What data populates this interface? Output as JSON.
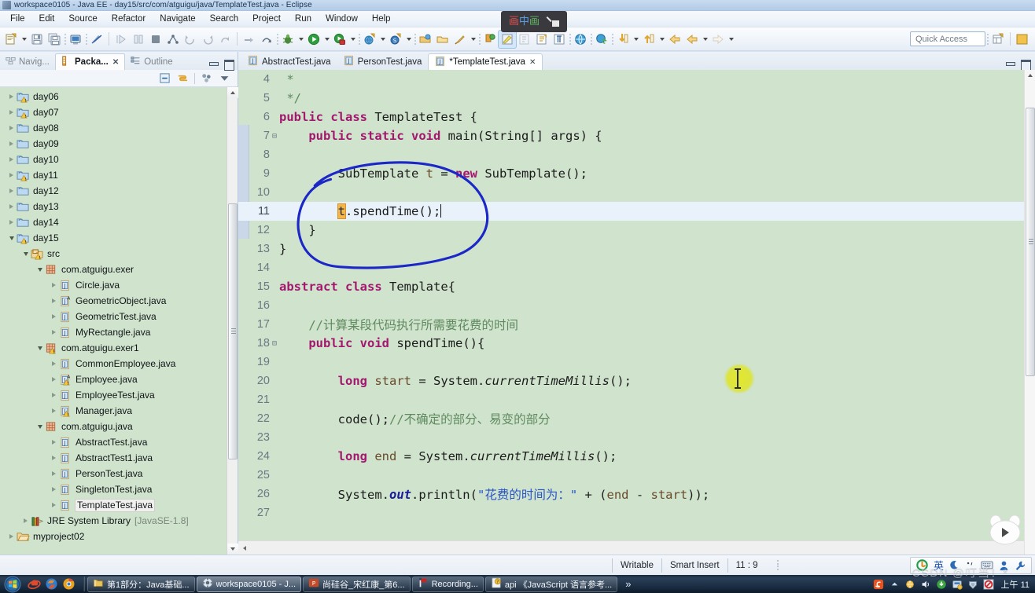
{
  "window": {
    "title": "workspace0105 - Java EE - day15/src/com/atguigu/java/TemplateTest.java - Eclipse"
  },
  "menubar": {
    "items": [
      "File",
      "Edit",
      "Source",
      "Refactor",
      "Navigate",
      "Search",
      "Project",
      "Run",
      "Window",
      "Help"
    ]
  },
  "pip": {
    "label_1": "画",
    "label_2": "中",
    "label_3": "画",
    "expand_icon": "expand-icon"
  },
  "toolbar": {
    "quick_access_placeholder": "Quick Access",
    "items": [
      "new-wizard-icon",
      "new-dropdown-arrow",
      "save-icon",
      "save-all-icon",
      "print-icon",
      "toggle-breakpoint-icon",
      "run-last-tool-icon",
      "skip-breakpoints-icon",
      "terminate-icon",
      "next-annotation-icon",
      "previous-annotation-icon",
      "back-icon",
      "forward-icon",
      "debug-step-icon",
      "debug-step-over-icon",
      "debug-icon",
      "debug-dropdown-arrow",
      "run-icon",
      "run-dropdown-arrow",
      "run-coverage-icon",
      "coverage-dropdown-arrow",
      "new-java-project-icon",
      "new-project-dropdown-arrow",
      "new-class-icon",
      "class-dropdown-arrow",
      "open-type-icon",
      "open-task-icon",
      "search-icon",
      "search-dropdown-arrow",
      "git-icon",
      "external-tools-icon",
      "java-editor-icon",
      "open-declaration-icon",
      "toggle-mark-occurrences-icon",
      "show-whitespace-icon",
      "open-web-browser-icon",
      "open-perspective-icon",
      "next-edit-icon",
      "next-edit-dropdown-arrow",
      "prev-edit-icon",
      "prev-edit-dropdown-arrow",
      "back-history-icon",
      "back-history-arrow",
      "forward-history-icon",
      "forward-history-arrow"
    ]
  },
  "left_view": {
    "tabs": [
      {
        "label": "Navig...",
        "icon": "navigator-icon",
        "active": false
      },
      {
        "label": "Packa...",
        "icon": "package-explorer-icon",
        "active": true,
        "closable": true
      },
      {
        "label": "Outline",
        "icon": "outline-icon",
        "active": false
      }
    ],
    "view_toolbar": [
      "collapse-all-icon",
      "link-with-editor-icon",
      "focus-on-active-task-icon",
      "view-menu-icon"
    ],
    "minimize_label": "minimize-icon",
    "maximize_label": "maximize-icon",
    "tree": [
      {
        "label": "day06",
        "depth": 0,
        "twist": "closed",
        "icon": "java-project-warning-icon"
      },
      {
        "label": "day07",
        "depth": 0,
        "twist": "closed",
        "icon": "java-project-warning-icon"
      },
      {
        "label": "day08",
        "depth": 0,
        "twist": "closed",
        "icon": "java-project-icon"
      },
      {
        "label": "day09",
        "depth": 0,
        "twist": "closed",
        "icon": "java-project-icon"
      },
      {
        "label": "day10",
        "depth": 0,
        "twist": "closed",
        "icon": "java-project-icon"
      },
      {
        "label": "day11",
        "depth": 0,
        "twist": "closed",
        "icon": "java-project-warning-icon"
      },
      {
        "label": "day12",
        "depth": 0,
        "twist": "closed",
        "icon": "java-project-icon"
      },
      {
        "label": "day13",
        "depth": 0,
        "twist": "closed",
        "icon": "java-project-icon"
      },
      {
        "label": "day14",
        "depth": 0,
        "twist": "closed",
        "icon": "java-project-icon"
      },
      {
        "label": "day15",
        "depth": 0,
        "twist": "open",
        "icon": "java-project-warning-icon"
      },
      {
        "label": "src",
        "depth": 1,
        "twist": "open",
        "icon": "source-folder-icon"
      },
      {
        "label": "com.atguigu.exer",
        "depth": 2,
        "twist": "open",
        "icon": "package-icon"
      },
      {
        "label": "Circle.java",
        "depth": 3,
        "twist": "closed",
        "icon": "java-file-icon"
      },
      {
        "label": "GeometricObject.java",
        "depth": 3,
        "twist": "closed",
        "icon": "java-abstract-file-icon"
      },
      {
        "label": "GeometricTest.java",
        "depth": 3,
        "twist": "closed",
        "icon": "java-file-icon"
      },
      {
        "label": "MyRectangle.java",
        "depth": 3,
        "twist": "closed",
        "icon": "java-file-icon"
      },
      {
        "label": "com.atguigu.exer1",
        "depth": 2,
        "twist": "open",
        "icon": "package-warning-icon"
      },
      {
        "label": "CommonEmployee.java",
        "depth": 3,
        "twist": "closed",
        "icon": "java-file-icon"
      },
      {
        "label": "Employee.java",
        "depth": 3,
        "twist": "closed",
        "icon": "java-abstract-warning-file-icon"
      },
      {
        "label": "EmployeeTest.java",
        "depth": 3,
        "twist": "closed",
        "icon": "java-file-icon"
      },
      {
        "label": "Manager.java",
        "depth": 3,
        "twist": "closed",
        "icon": "java-warning-file-icon"
      },
      {
        "label": "com.atguigu.java",
        "depth": 2,
        "twist": "open",
        "icon": "package-icon"
      },
      {
        "label": "AbstractTest.java",
        "depth": 3,
        "twist": "closed",
        "icon": "java-file-icon"
      },
      {
        "label": "AbstractTest1.java",
        "depth": 3,
        "twist": "closed",
        "icon": "java-file-icon"
      },
      {
        "label": "PersonTest.java",
        "depth": 3,
        "twist": "closed",
        "icon": "java-file-icon"
      },
      {
        "label": "SingletonTest.java",
        "depth": 3,
        "twist": "closed",
        "icon": "java-file-icon"
      },
      {
        "label": "TemplateTest.java",
        "depth": 3,
        "twist": "closed",
        "icon": "java-file-icon",
        "selected": true
      },
      {
        "label": "JRE System Library",
        "depth": 1,
        "twist": "closed",
        "icon": "library-icon",
        "suffix": "[JavaSE-1.8]"
      },
      {
        "label": "myproject02",
        "depth": 0,
        "twist": "closed",
        "icon": "closed-project-icon"
      }
    ]
  },
  "editor": {
    "tabs": [
      {
        "label": "AbstractTest.java",
        "icon": "java-file-icon",
        "active": false,
        "closable": false
      },
      {
        "label": "PersonTest.java",
        "icon": "java-file-icon",
        "active": false,
        "closable": false
      },
      {
        "label": "*TemplateTest.java",
        "icon": "java-file-icon",
        "active": true,
        "closable": true
      }
    ],
    "lines": [
      {
        "n": "4",
        "fold": "",
        "highlight": false,
        "tokens": [
          {
            "t": " * ",
            "c": "cmt"
          }
        ]
      },
      {
        "n": "5",
        "fold": "",
        "highlight": false,
        "tokens": [
          {
            "t": " */",
            "c": "cmt"
          }
        ]
      },
      {
        "n": "6",
        "fold": "",
        "highlight": false,
        "tokens": [
          {
            "t": "public",
            "c": "kw"
          },
          {
            "t": " ",
            "c": "pln"
          },
          {
            "t": "class",
            "c": "kw"
          },
          {
            "t": " TemplateTest {",
            "c": "pln"
          }
        ]
      },
      {
        "n": "7",
        "fold": "-",
        "highlight": false,
        "tokens": [
          {
            "t": "    ",
            "c": "pln"
          },
          {
            "t": "public",
            "c": "kw"
          },
          {
            "t": " ",
            "c": "pln"
          },
          {
            "t": "static",
            "c": "kw"
          },
          {
            "t": " ",
            "c": "pln"
          },
          {
            "t": "void",
            "c": "kw"
          },
          {
            "t": " main(String[] args) {",
            "c": "pln"
          }
        ]
      },
      {
        "n": "8",
        "fold": "",
        "highlight": false,
        "tokens": [
          {
            "t": "",
            "c": "pln"
          }
        ]
      },
      {
        "n": "9",
        "fold": "",
        "highlight": false,
        "tokens": [
          {
            "t": "        SubTemplate ",
            "c": "pln"
          },
          {
            "t": "t",
            "c": "loc"
          },
          {
            "t": " = ",
            "c": "pln"
          },
          {
            "t": "new",
            "c": "kw"
          },
          {
            "t": " SubTemplate();",
            "c": "pln"
          }
        ]
      },
      {
        "n": "10",
        "fold": "",
        "highlight": false,
        "tokens": [
          {
            "t": "",
            "c": "pln"
          }
        ]
      },
      {
        "n": "11",
        "fold": "",
        "highlight": true,
        "tokens": [
          {
            "t": "        ",
            "c": "pln"
          },
          {
            "t": "t",
            "c": "sel"
          },
          {
            "t": ".spendTime();",
            "c": "pln"
          },
          {
            "t": "|",
            "c": "caret"
          }
        ]
      },
      {
        "n": "12",
        "fold": "",
        "highlight": false,
        "tokens": [
          {
            "t": "    }",
            "c": "pln"
          }
        ]
      },
      {
        "n": "13",
        "fold": "",
        "highlight": false,
        "tokens": [
          {
            "t": "}",
            "c": "pln"
          }
        ]
      },
      {
        "n": "14",
        "fold": "",
        "highlight": false,
        "tokens": [
          {
            "t": "",
            "c": "pln"
          }
        ]
      },
      {
        "n": "15",
        "fold": "",
        "highlight": false,
        "tokens": [
          {
            "t": "abstract",
            "c": "kw"
          },
          {
            "t": " ",
            "c": "pln"
          },
          {
            "t": "class",
            "c": "kw"
          },
          {
            "t": " Template{",
            "c": "pln"
          }
        ]
      },
      {
        "n": "16",
        "fold": "",
        "highlight": false,
        "tokens": [
          {
            "t": "",
            "c": "pln"
          }
        ]
      },
      {
        "n": "17",
        "fold": "",
        "highlight": false,
        "tokens": [
          {
            "t": "    //计算某段代码执行所需要花费的时间",
            "c": "cmt"
          }
        ]
      },
      {
        "n": "18",
        "fold": "-",
        "highlight": false,
        "tokens": [
          {
            "t": "    ",
            "c": "pln"
          },
          {
            "t": "public",
            "c": "kw"
          },
          {
            "t": " ",
            "c": "pln"
          },
          {
            "t": "void",
            "c": "kw"
          },
          {
            "t": " spendTime(){",
            "c": "pln"
          }
        ]
      },
      {
        "n": "19",
        "fold": "",
        "highlight": false,
        "tokens": [
          {
            "t": "",
            "c": "pln"
          }
        ]
      },
      {
        "n": "20",
        "fold": "",
        "highlight": false,
        "tokens": [
          {
            "t": "        ",
            "c": "pln"
          },
          {
            "t": "long",
            "c": "kw"
          },
          {
            "t": " ",
            "c": "pln"
          },
          {
            "t": "start",
            "c": "loc"
          },
          {
            "t": " = System.",
            "c": "pln"
          },
          {
            "t": "currentTimeMillis",
            "c": "smth"
          },
          {
            "t": "();",
            "c": "pln"
          }
        ]
      },
      {
        "n": "21",
        "fold": "",
        "highlight": false,
        "tokens": [
          {
            "t": "",
            "c": "pln"
          }
        ]
      },
      {
        "n": "22",
        "fold": "",
        "highlight": false,
        "tokens": [
          {
            "t": "        code();",
            "c": "pln"
          },
          {
            "t": "//不确定的部分、易变的部分",
            "c": "cmt"
          }
        ]
      },
      {
        "n": "23",
        "fold": "",
        "highlight": false,
        "tokens": [
          {
            "t": "",
            "c": "pln"
          }
        ]
      },
      {
        "n": "24",
        "fold": "",
        "highlight": false,
        "tokens": [
          {
            "t": "        ",
            "c": "pln"
          },
          {
            "t": "long",
            "c": "kw"
          },
          {
            "t": " ",
            "c": "pln"
          },
          {
            "t": "end",
            "c": "loc"
          },
          {
            "t": " = System.",
            "c": "pln"
          },
          {
            "t": "currentTimeMillis",
            "c": "smth"
          },
          {
            "t": "();",
            "c": "pln"
          }
        ]
      },
      {
        "n": "25",
        "fold": "",
        "highlight": false,
        "tokens": [
          {
            "t": "",
            "c": "pln"
          }
        ]
      },
      {
        "n": "26",
        "fold": "",
        "highlight": false,
        "tokens": [
          {
            "t": "        System.",
            "c": "pln"
          },
          {
            "t": "out",
            "c": "sfld"
          },
          {
            "t": ".println(",
            "c": "pln"
          },
          {
            "t": "\"花费的时间为：\"",
            "c": "str"
          },
          {
            "t": " + (",
            "c": "pln"
          },
          {
            "t": "end",
            "c": "loc"
          },
          {
            "t": " - ",
            "c": "pln"
          },
          {
            "t": "start",
            "c": "loc"
          },
          {
            "t": "));",
            "c": "pln"
          }
        ]
      },
      {
        "n": "27",
        "fold": "",
        "highlight": false,
        "tokens": [
          {
            "t": "",
            "c": "pln"
          }
        ]
      }
    ],
    "annotation": {
      "type": "hand-drawn-ellipse",
      "color": "#1c27c8",
      "description": "blue circle around t.spendTime() call"
    }
  },
  "statusbar": {
    "writable": "Writable",
    "insert_mode": "Smart Insert",
    "position": "11 : 9",
    "ime": [
      "ime-logo-icon",
      "英",
      "moon-icon",
      "punctuation-icon",
      "keyboard-icon",
      "user-icon",
      "tools-icon"
    ]
  },
  "taskbar": {
    "start": "start-orb-icon",
    "quicklaunch": [
      "ie-icon",
      "firefox-icon",
      "chrome-icon"
    ],
    "buttons": [
      {
        "label": "第1部分：Java基础...",
        "icon": "folder-icon",
        "active": false
      },
      {
        "label": "workspace0105 - J...",
        "icon": "eclipse-icon",
        "active": true
      },
      {
        "label": "尚硅谷_宋红康_第6...",
        "icon": "powerpoint-icon",
        "active": false
      },
      {
        "label": "Recording...",
        "icon": "recorder-icon",
        "active": false
      },
      {
        "label": "api 《JavaScript 语言参考...",
        "icon": "help-icon",
        "active": false
      }
    ],
    "overflow": "»",
    "tray": [
      "sogou-icon",
      "show-hidden-icon",
      "network-icon",
      "volume-icon",
      "update-icon",
      "security-icon",
      "shield-icon",
      "block-icon"
    ],
    "clock": "上午 11"
  },
  "watermark": "CSDN @叮当！*"
}
